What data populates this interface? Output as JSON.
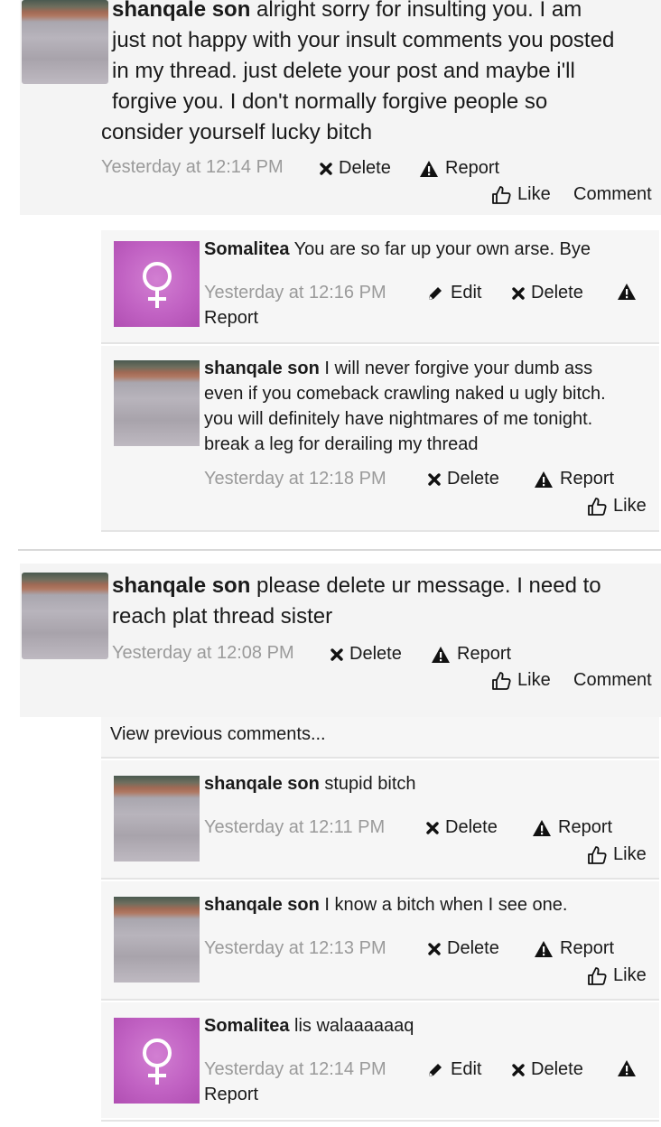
{
  "status1": {
    "author": "shanqale son",
    "lines": [
      " alright sorry for insulting you. I am",
      "just not happy with your insult comments you posted",
      "in my thread. just delete your post and maybe i'll",
      "forgive you. I don't normally forgive people so",
      "consider yourself lucky bitch"
    ],
    "time": "Yesterday at 12:14 PM",
    "delete": "Delete",
    "report": "Report",
    "like": "Like",
    "comment": "Comment",
    "comments": [
      {
        "author": "Somalitea",
        "text": " You are so far up your own arse. Bye",
        "time": "Yesterday at 12:16 PM",
        "edit": "Edit",
        "delete": "Delete",
        "report": "Report"
      },
      {
        "author": "shanqale son",
        "lines": [
          " I will never forgive your dumb ass",
          "even if you comeback crawling naked u ugly bitch.",
          "you will definitely have nightmares of me tonight.",
          "break a leg for derailing my thread"
        ],
        "time": "Yesterday at 12:18 PM",
        "delete": "Delete",
        "report": "Report",
        "like": "Like"
      }
    ]
  },
  "status2": {
    "author": "shanqale son",
    "lines": [
      " please delete ur message. I need to",
      "reach plat thread sister"
    ],
    "time": "Yesterday at 12:08 PM",
    "delete": "Delete",
    "report": "Report",
    "like": "Like",
    "comment": "Comment",
    "view_previous": "View previous comments...",
    "comments": [
      {
        "author": "shanqale son",
        "text": " stupid bitch",
        "time": "Yesterday at 12:11 PM",
        "delete": "Delete",
        "report": "Report",
        "like": "Like"
      },
      {
        "author": "shanqale son",
        "text": " I know a bitch when I see one.",
        "time": "Yesterday at 12:13 PM",
        "delete": "Delete",
        "report": "Report",
        "like": "Like"
      },
      {
        "author": "Somalitea",
        "text": " lis walaaaaaaq",
        "time": "Yesterday at 12:14 PM",
        "edit": "Edit",
        "delete": "Delete",
        "report": "Report"
      }
    ]
  },
  "colors": {
    "female_avatar": "#c162c3",
    "meta_text": "#9a9a9a",
    "status_bg": "#f4f4f4",
    "comment_bg": "#f6f6f6"
  },
  "icons": {
    "delete": "x-icon",
    "report": "warning-icon",
    "edit": "pencil-icon",
    "like": "thumbs-up-icon",
    "female": "female-symbol-icon"
  }
}
